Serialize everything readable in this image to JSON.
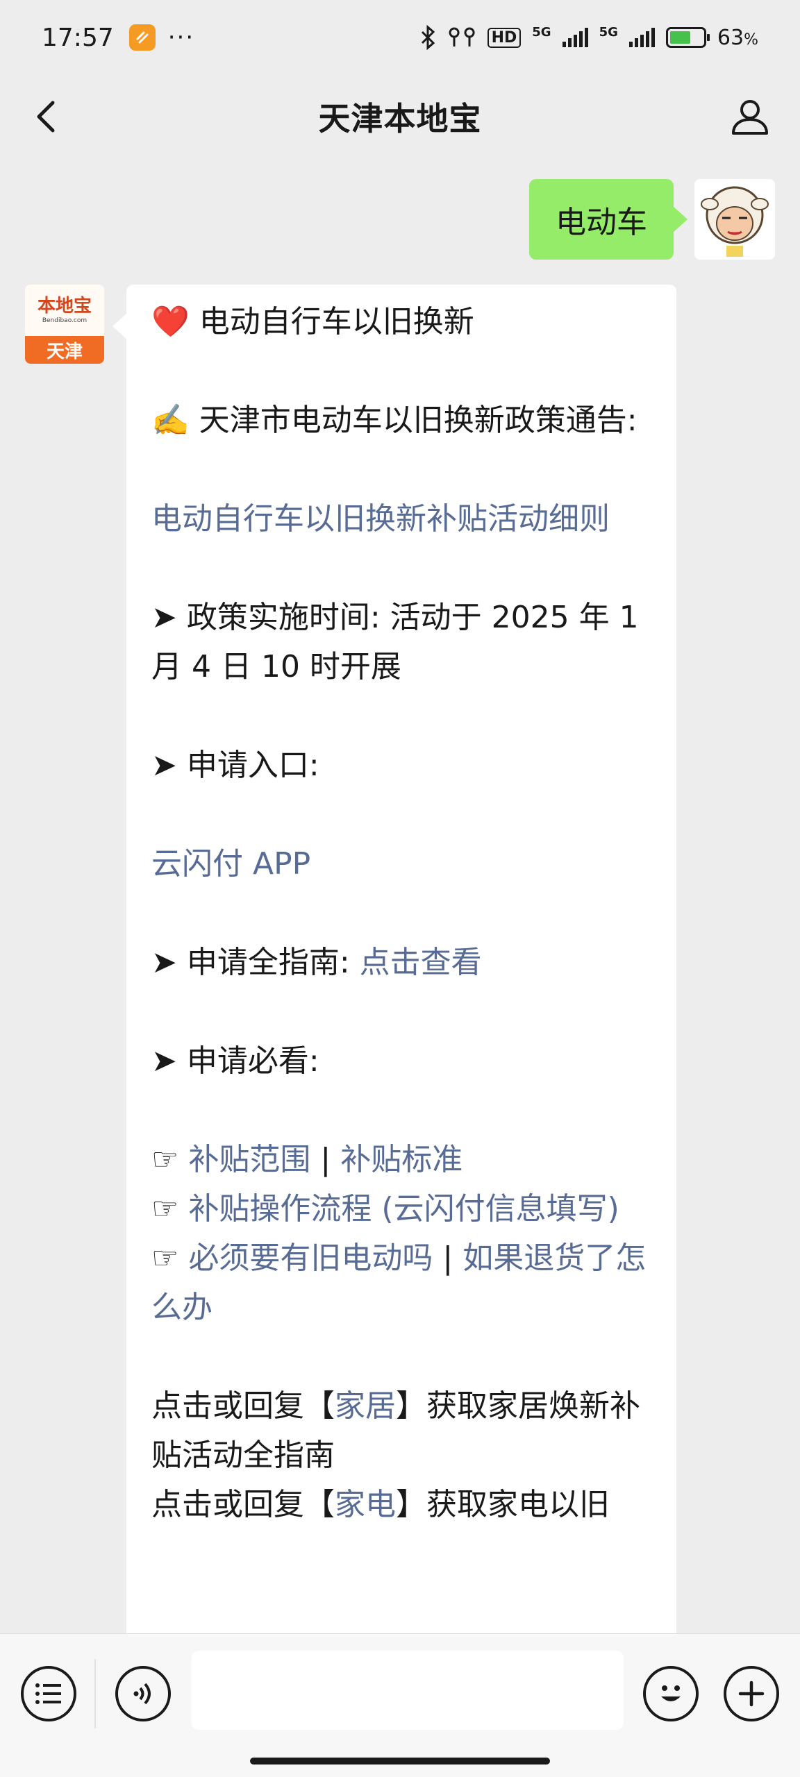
{
  "status_bar": {
    "time": "17:57",
    "dots": "···",
    "net1": "5G",
    "net2": "5G",
    "hd": "HD",
    "battery": "63",
    "battery_unit": "%",
    "battery_level": 0.63
  },
  "header": {
    "title": "天津本地宝"
  },
  "chat": {
    "outgoing": {
      "text": "电动车"
    },
    "bot_avatar": {
      "brand": "本地宝",
      "url": "Bendibao.com",
      "city": "天津"
    },
    "incoming": {
      "line1_emoji": "❤️",
      "line1": " 电动自行车以旧换新",
      "line2_emoji": "✍️",
      "line2": " 天津市电动车以旧换新政策通告:",
      "rules_link": "电动自行车以旧换新补贴活动细则",
      "arrow": "➤",
      "time_label": " 政策实施时间: 活动于 2025 年 1 月 4 日 10 时开展",
      "entry_label": " 申请入口:",
      "entry_link": "云闪付 APP",
      "guide_label": " 申请全指南: ",
      "guide_link": "点击查看",
      "must_label": " 申请必看:",
      "hand": "☞ ",
      "scope_link": "补贴范围",
      "divider": " | ",
      "standard_link": "补贴标准",
      "process_link": "补贴操作流程 (云闪付信息填写)",
      "old_link": "必须要有旧电动吗",
      "return_link": "如果退货了怎么办",
      "home_pre": "点击或回复【",
      "home_link": "家居",
      "home_post": "】获取家居焕新补贴活动全指南",
      "appl_pre": "点击或回复【",
      "appl_link": "家电",
      "appl_post": "】获取家电以旧"
    }
  },
  "toolbar": {
    "list_icon": "list-icon",
    "voice_icon": "voice-icon",
    "emoji_icon": "emoji-icon",
    "plus_icon": "plus-icon"
  }
}
